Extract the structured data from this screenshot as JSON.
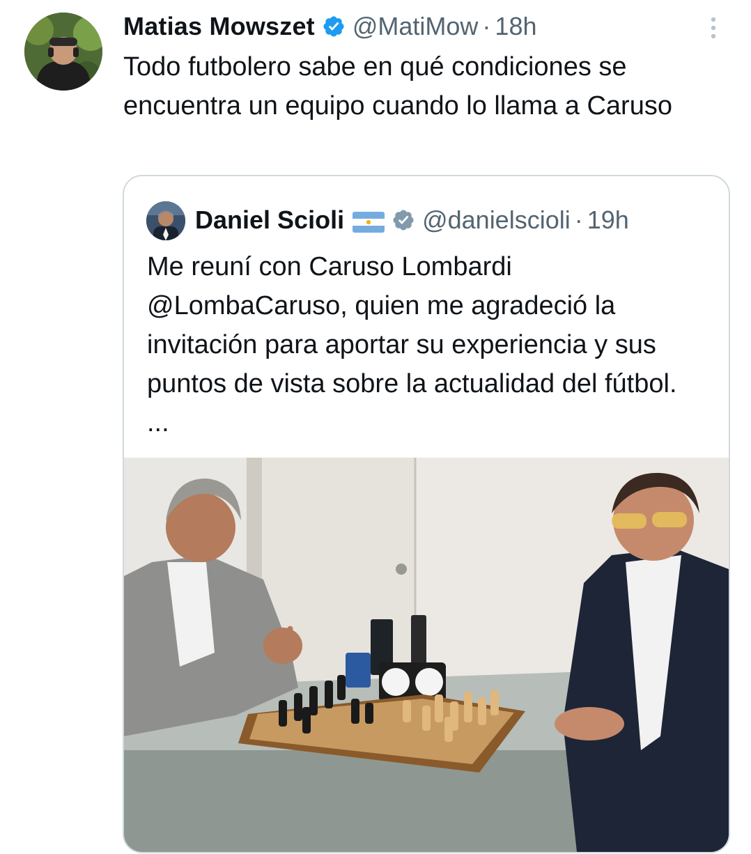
{
  "tweet": {
    "author": {
      "name": "Matias Mowszet",
      "handle": "@MatiMow",
      "separator": "·",
      "time": "18h"
    },
    "text": "Todo futbolero sabe en qué condiciones se encuentra un equipo cuando lo llama a Caruso"
  },
  "quoted_tweet": {
    "author": {
      "name": "Daniel Scioli",
      "handle": "@danielscioli",
      "separator": "·",
      "time": "19h"
    },
    "text": "Me reuní con Caruso Lombardi @LombaCaruso, quien me agradeció la invitación para aportar su experiencia y sus puntos de vista sobre la actualidad del fútbol. ..."
  },
  "colors": {
    "verified_blue": "#1d9bf0",
    "verified_gray": "#829aab",
    "muted_text": "#536471",
    "border": "#cfd9de"
  },
  "icons": {
    "verified": "verified-badge-icon",
    "more": "more-vertical-icon",
    "flag": "argentina-flag-icon"
  }
}
